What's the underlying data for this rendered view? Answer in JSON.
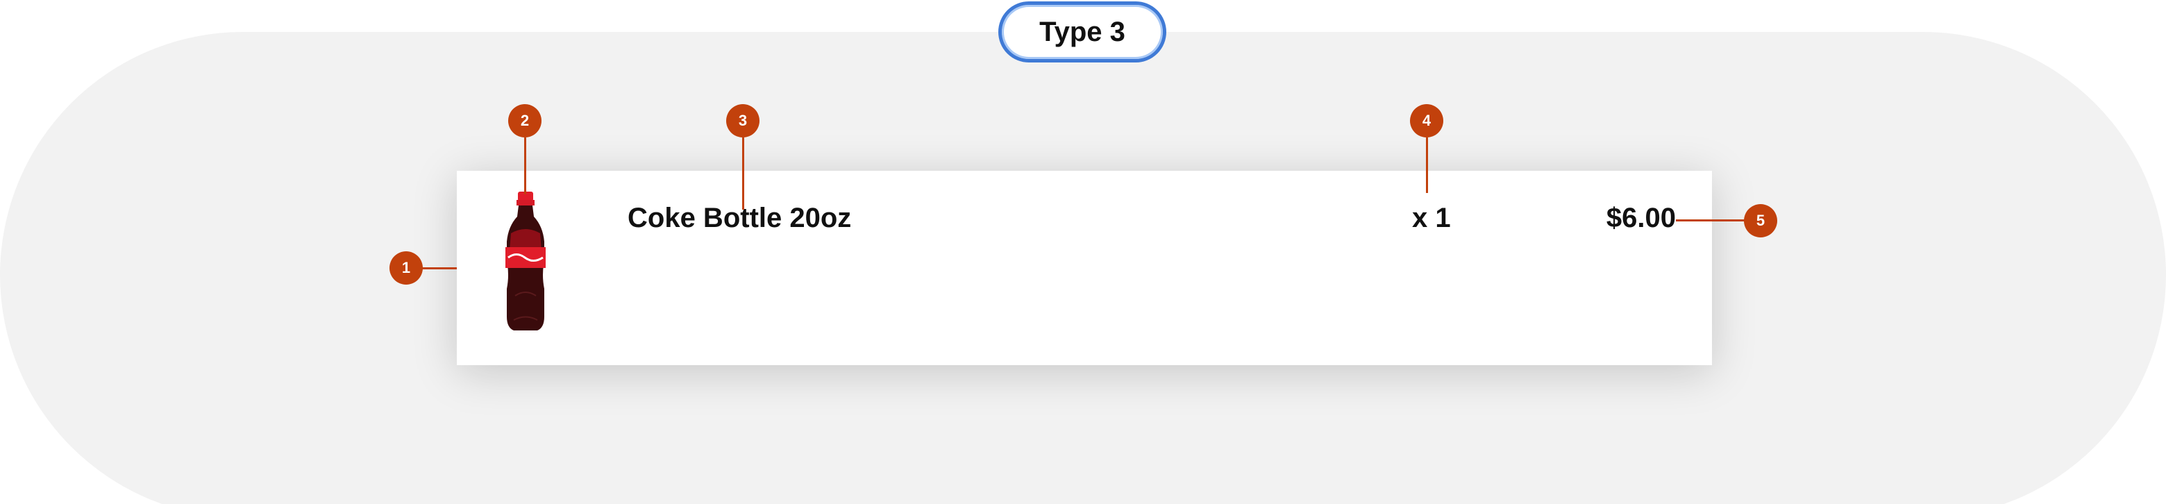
{
  "type_label": "Type 3",
  "item": {
    "name": "Coke Bottle 20oz",
    "quantity": "x 1",
    "price": "$6.00",
    "image_icon": "coke-bottle-image"
  },
  "callouts": [
    "1",
    "2",
    "3",
    "4",
    "5"
  ],
  "colors": {
    "callout": "#c2410c",
    "pill_border": "#3f7ad6",
    "background": "#f2f2f2"
  }
}
